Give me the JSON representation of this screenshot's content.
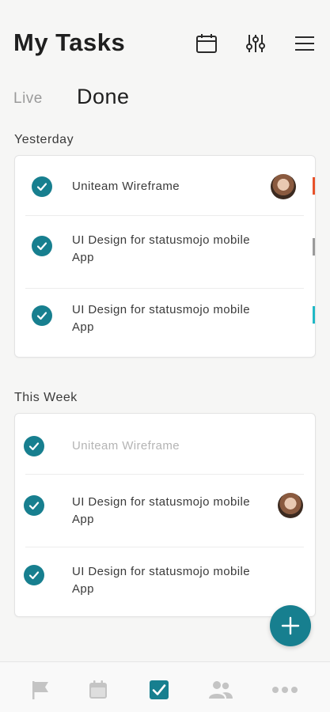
{
  "header": {
    "title": "My Tasks",
    "icons": [
      "calendar-icon",
      "filter-sliders-icon",
      "menu-icon"
    ]
  },
  "tabs": [
    {
      "label": "Live",
      "active": false
    },
    {
      "label": "Done",
      "active": true
    }
  ],
  "sections": [
    {
      "label": "Yesterday",
      "tasks": [
        {
          "text": "Uniteam Wireframe",
          "done": true,
          "avatar": true,
          "stripe": "#e8522a"
        },
        {
          "text": "UI Design for statusmojo mobile App",
          "done": true,
          "avatar": false,
          "stripe": "#9a9a9a"
        },
        {
          "text": "UI Design for statusmojo mobile App",
          "done": true,
          "avatar": false,
          "stripe": "#20b8c6"
        }
      ]
    },
    {
      "label": "This Week",
      "tasks": [
        {
          "text": "Uniteam Wireframe",
          "done": true,
          "avatar": false,
          "muted": true
        },
        {
          "text": "UI Design for statusmojo mobile App",
          "done": true,
          "avatar": true
        },
        {
          "text": "UI Design for statusmojo mobile App",
          "done": true,
          "avatar": false
        }
      ]
    }
  ],
  "fab": {
    "icon": "plus-icon"
  },
  "bottom_nav": [
    {
      "icon": "flag-icon",
      "active": false
    },
    {
      "icon": "calendar-icon",
      "active": false
    },
    {
      "icon": "checkbox-icon",
      "active": true
    },
    {
      "icon": "people-icon",
      "active": false
    },
    {
      "icon": "more-icon",
      "active": false
    }
  ],
  "colors": {
    "accent": "#177f8f",
    "background": "#f6f6f5",
    "inactive_icon": "#c4c4c4"
  }
}
